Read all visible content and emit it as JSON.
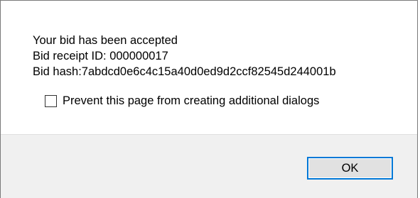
{
  "dialog": {
    "message_lines": [
      "Your bid has been accepted",
      "Bid receipt ID: 000000017",
      "Bid hash:7abdcd0e6c4c15a40d0ed9d2ccf82545d244001b"
    ],
    "checkbox": {
      "label": "Prevent this page from creating additional dialogs",
      "checked": false
    },
    "ok_label": "OK"
  },
  "colors": {
    "accent": "#0078d7",
    "footer_bg": "#f0f0f0",
    "button_bg": "#e1e1e1"
  }
}
